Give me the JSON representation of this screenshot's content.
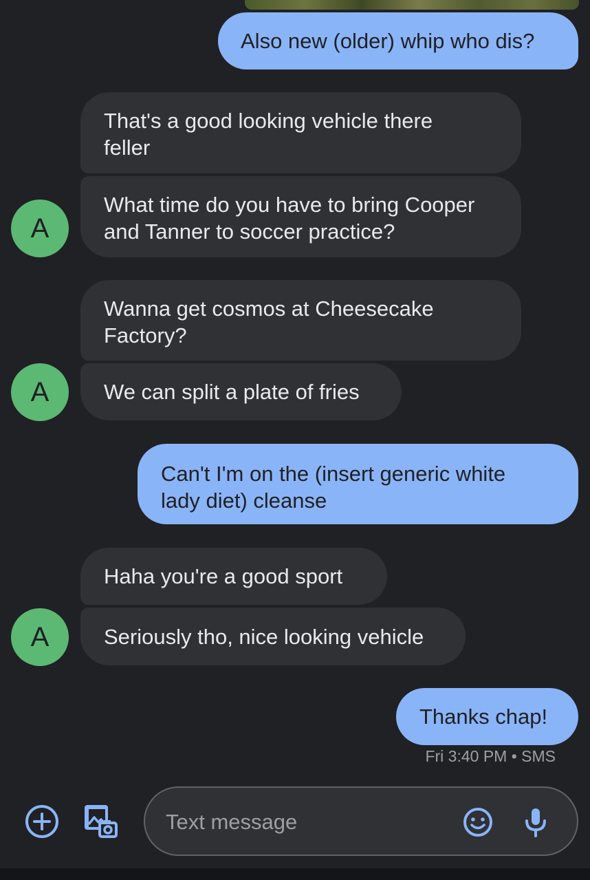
{
  "conversation": {
    "messages": [
      {
        "direction": "outgoing",
        "text": "Also new (older) whip who dis?"
      },
      {
        "direction": "incoming",
        "text_lines": [
          "That's a good looking vehicle there",
          "feller"
        ]
      },
      {
        "direction": "incoming",
        "text_lines": [
          "What time do you have to bring Cooper",
          "and Tanner to soccer practice?"
        ]
      },
      {
        "direction": "incoming",
        "text_lines": [
          "Wanna get cosmos at Cheesecake",
          "Factory?"
        ]
      },
      {
        "direction": "incoming",
        "text": "We can split a plate of fries"
      },
      {
        "direction": "outgoing",
        "text_lines": [
          "Can't I'm on the (insert generic white",
          "lady diet) cleanse"
        ]
      },
      {
        "direction": "incoming",
        "text": "Haha you're a good sport"
      },
      {
        "direction": "incoming",
        "text": "Seriously tho, nice looking vehicle"
      },
      {
        "direction": "outgoing",
        "text": "Thanks chap!"
      }
    ],
    "contact_initial": "A",
    "last_message_meta": "Fri 3:40 PM • SMS"
  },
  "compose": {
    "placeholder": "Text message",
    "add_icon": "add-circle-icon",
    "gallery_icon": "gallery-camera-icon",
    "emoji_icon": "emoji-icon",
    "mic_icon": "microphone-icon"
  },
  "colors": {
    "background": "#202124",
    "outgoing_bubble": "#8ab4f8",
    "incoming_bubble": "#303134",
    "avatar": "#5bb974",
    "accent_icon": "#8ab4f8"
  }
}
